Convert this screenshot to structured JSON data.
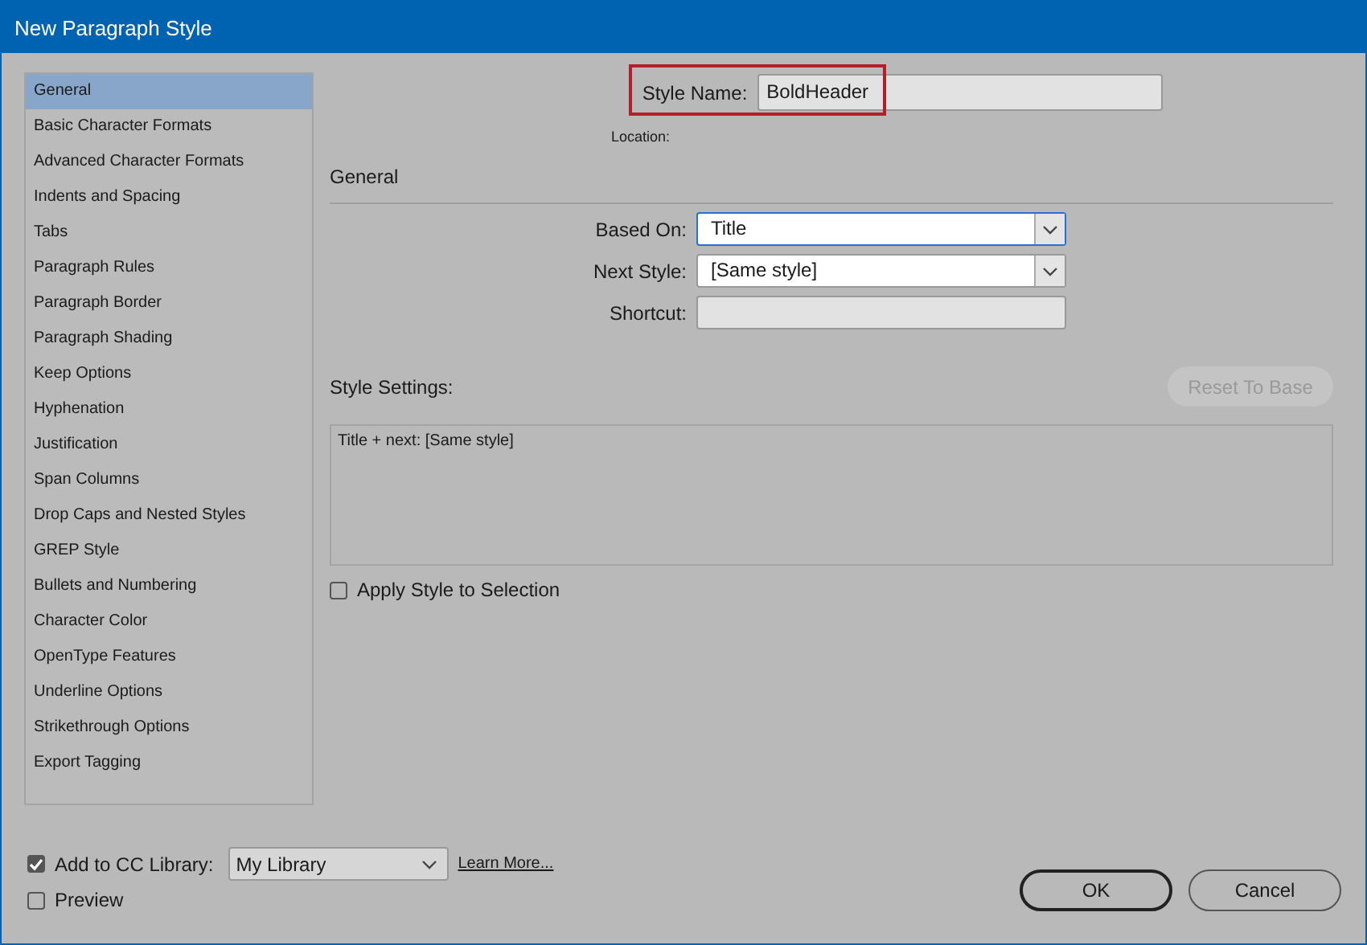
{
  "window": {
    "title": "New Paragraph Style"
  },
  "sidebar": {
    "items": [
      {
        "label": "General",
        "selected": true
      },
      {
        "label": "Basic Character Formats",
        "selected": false
      },
      {
        "label": "Advanced Character Formats",
        "selected": false
      },
      {
        "label": "Indents and Spacing",
        "selected": false
      },
      {
        "label": "Tabs",
        "selected": false
      },
      {
        "label": "Paragraph Rules",
        "selected": false
      },
      {
        "label": "Paragraph Border",
        "selected": false
      },
      {
        "label": "Paragraph Shading",
        "selected": false
      },
      {
        "label": "Keep Options",
        "selected": false
      },
      {
        "label": "Hyphenation",
        "selected": false
      },
      {
        "label": "Justification",
        "selected": false
      },
      {
        "label": "Span Columns",
        "selected": false
      },
      {
        "label": "Drop Caps and Nested Styles",
        "selected": false
      },
      {
        "label": "GREP Style",
        "selected": false
      },
      {
        "label": "Bullets and Numbering",
        "selected": false
      },
      {
        "label": "Character Color",
        "selected": false
      },
      {
        "label": "OpenType Features",
        "selected": false
      },
      {
        "label": "Underline Options",
        "selected": false
      },
      {
        "label": "Strikethrough Options",
        "selected": false
      },
      {
        "label": "Export Tagging",
        "selected": false
      }
    ]
  },
  "style_name": {
    "label": "Style Name:",
    "value": "BoldHeader"
  },
  "location": {
    "label": "Location:"
  },
  "section_title": "General",
  "fields": [
    {
      "label": "Based On:",
      "kind": "dropdown",
      "value": "Title",
      "focused": true
    },
    {
      "label": "Next Style:",
      "kind": "dropdown",
      "value": "[Same style]",
      "focused": false
    },
    {
      "label": "Shortcut:",
      "kind": "text",
      "focused": false
    }
  ],
  "style_settings": {
    "label": "Style Settings:",
    "reset_button": {
      "label": "Reset To Base",
      "disabled": true
    },
    "summary": "Title + next: [Same style]"
  },
  "apply_to_selection": {
    "label": "Apply Style to Selection",
    "checked": false
  },
  "footer": {
    "cc_library": {
      "label": "Add to CC Library:",
      "checked": true,
      "value": "My Library",
      "link": "Learn More..."
    },
    "preview": {
      "label": "Preview",
      "checked": false
    },
    "buttons": [
      {
        "label": "OK",
        "default": true
      },
      {
        "label": "Cancel",
        "default": false
      }
    ]
  }
}
